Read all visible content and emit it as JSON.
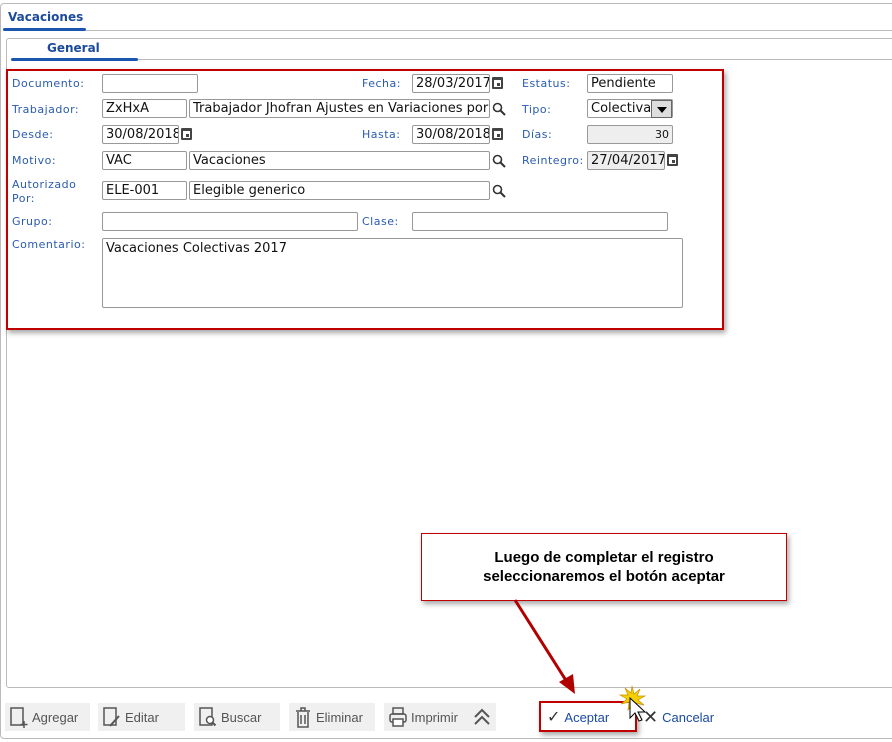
{
  "tabs": {
    "main": "Vacaciones",
    "sub": "General"
  },
  "form": {
    "documento": {
      "label": "Documento:",
      "value": ""
    },
    "fecha": {
      "label": "Fecha:",
      "value": "28/03/2017"
    },
    "estatus": {
      "label": "Estatus:",
      "value": "Pendiente"
    },
    "trabajador": {
      "label": "Trabajador:",
      "code": "ZxHxA",
      "name": "Trabajador Jhofran Ajustes en Variaciones por"
    },
    "tipo": {
      "label": "Tipo:",
      "value": "Colectiva"
    },
    "desde": {
      "label": "Desde:",
      "value": "30/08/2018"
    },
    "hasta": {
      "label": "Hasta:",
      "value": "30/08/2018"
    },
    "dias": {
      "label": "Días:",
      "value": "30"
    },
    "motivo": {
      "label": "Motivo:",
      "code": "VAC",
      "name": "Vacaciones"
    },
    "reintegro": {
      "label": "Reintegro:",
      "value": "27/04/2017"
    },
    "autorizado": {
      "label1": "Autorizado",
      "label2": "Por:",
      "code": "ELE-001",
      "name": "Elegible generico"
    },
    "grupo": {
      "label": "Grupo:",
      "value": ""
    },
    "clase": {
      "label": "Clase:",
      "value": ""
    },
    "comentario": {
      "label": "Comentario:",
      "value": "Vacaciones Colectivas 2017"
    }
  },
  "note": {
    "line1": "Luego de completar el registro",
    "line2": "seleccionaremos el botón aceptar"
  },
  "toolbar": {
    "agregar": "Agregar",
    "editar": "Editar",
    "buscar": "Buscar",
    "eliminar": "Eliminar",
    "imprimir": "Imprimir",
    "aceptar": "Aceptar",
    "cancelar": "Cancelar"
  },
  "colors": {
    "accent": "#1a55b0",
    "highlight": "#c00000"
  }
}
